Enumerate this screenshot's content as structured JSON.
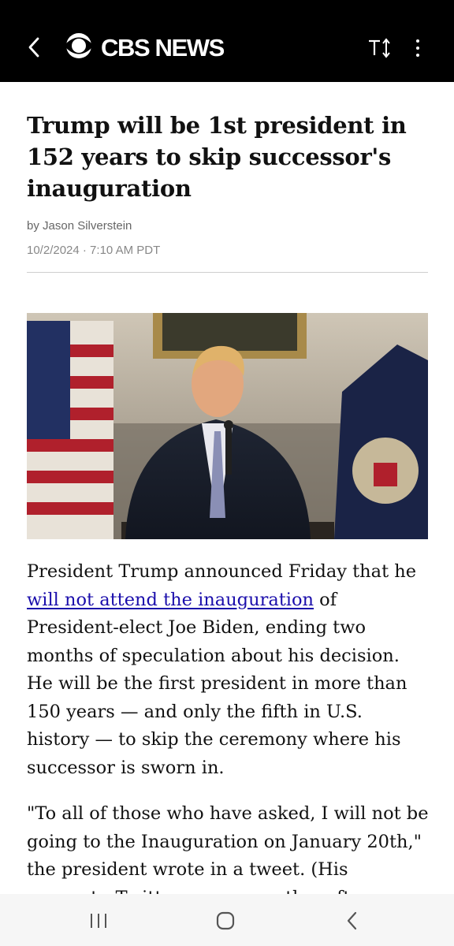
{
  "app_bar": {
    "brand": "CBS NEWS",
    "text_size_label": "TT",
    "icons": [
      "back-arrow-icon",
      "cbs-eye-logo",
      "text-size-icon",
      "more-vert-icon"
    ]
  },
  "article": {
    "headline": "Trump will be 1st president in 152 years to skip successor's inauguration",
    "byline": "by Jason Silverstein",
    "dateline": "10/2/2024 · 7:10 AM PDT",
    "paragraph1": {
      "before_link": "President Trump announced Friday that he ",
      "link": "will not attend the inauguration",
      "after_link": " of President-elect Joe Biden, ending two months of speculation about his decision. He will be the first president in more than 150 years — and only the fifth in U.S. history — to skip the ceremony where his successor is sworn in."
    },
    "paragraph2": "\"To all of those who have asked, I will not be going to the Inauguration on January 20th,\" the president wrote in a tweet. (His account…Twitter…perm…ently…afte…"
  },
  "nav_bar": {
    "icons": [
      "recent-apps-icon",
      "home-icon",
      "back-icon"
    ]
  },
  "colors": {
    "app_bar_bg": "#000000",
    "link": "#1a0dab",
    "text": "#111111",
    "meta": "#666666"
  }
}
